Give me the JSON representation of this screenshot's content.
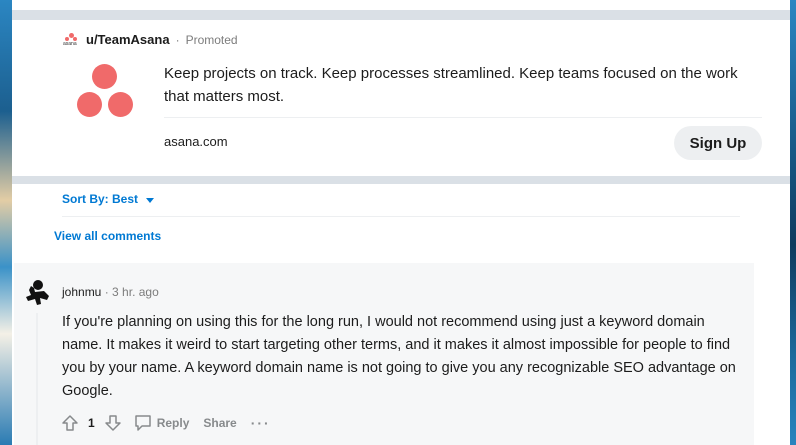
{
  "ad": {
    "username": "u/TeamAsana",
    "separator": "·",
    "promoted": "Promoted",
    "mini_logo_word": "asana",
    "text": "Keep projects on track. Keep processes streamlined. Keep teams focused on the work that matters most.",
    "domain": "asana.com",
    "cta_label": "Sign Up",
    "logo_color": "#f06a6a",
    "icon": "asana-logo-icon"
  },
  "comments_header": {
    "sort_label": "Sort By: Best",
    "view_all": "View all comments",
    "link_color": "#0079d3"
  },
  "comment": {
    "author": "johnmu",
    "separator": "·",
    "time": "3 hr. ago",
    "body": "If you're planning on using this for the long run, I would not recommend using just a keyword domain name. It makes it weird to start targeting other terms, and it makes it almost impossible for people to find you by your name. A keyword domain name is not going to give you any recognizable SEO advantage on Google.",
    "votes": "1",
    "reply_label": "Reply",
    "share_label": "Share",
    "more_label": "···",
    "icons": [
      "upvote-icon",
      "downvote-icon",
      "comment-bubble-icon",
      "more-options-icon"
    ]
  }
}
